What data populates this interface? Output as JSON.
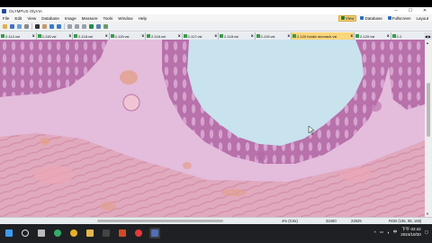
{
  "window": {
    "title": "OLYMPUS OlyVIA",
    "controls": {
      "minimize": "─",
      "maximize": "☐",
      "close": "✕"
    }
  },
  "menu": [
    "File",
    "Edit",
    "View",
    "Database",
    "Image",
    "Measure",
    "Tools",
    "Window",
    "Help"
  ],
  "right_tools": [
    {
      "label": "View",
      "active": true,
      "icon_color": "#2b7a2b"
    },
    {
      "label": "Database",
      "active": false,
      "icon_color": "#2a6fbf"
    },
    {
      "label": "Fullscreen",
      "active": false,
      "icon_color": "#2a6fbf"
    },
    {
      "label": "Layout",
      "active": false,
      "icon_color": "#555555"
    }
  ],
  "tabs": [
    {
      "label": "2-112.vsi",
      "active": false
    },
    {
      "label": "2-115.vsi",
      "active": false
    },
    {
      "label": "2-118.vsi",
      "active": false
    },
    {
      "label": "2-119.vsi",
      "active": false
    },
    {
      "label": "2-116.vsi",
      "active": false
    },
    {
      "label": "2-117.vsi",
      "active": false
    },
    {
      "label": "2-118.vsi",
      "active": false
    },
    {
      "label": "2-119.vsi",
      "active": false
    },
    {
      "label": "2-120 fundic stomach.vsi",
      "active": true
    },
    {
      "label": "2-120.vsi",
      "active": false
    },
    {
      "label": "2-1",
      "active": false
    }
  ],
  "tab_close": "x",
  "status": {
    "zoom": "4% (0.8x)",
    "width": "32450",
    "height": "22525",
    "rgb": "RGB (155, 88, 166)"
  },
  "taskbar": {
    "apps": [
      {
        "name": "windows-start",
        "color": "#3c9cf0"
      },
      {
        "name": "search",
        "color": "#dddddd"
      },
      {
        "name": "task-view",
        "color": "#bbbbbb"
      },
      {
        "name": "edge",
        "color": "#2fae6b"
      },
      {
        "name": "chrome",
        "color": "#e6b026"
      },
      {
        "name": "explorer",
        "color": "#e8b64a"
      },
      {
        "name": "store",
        "color": "#444444"
      },
      {
        "name": "powerpoint",
        "color": "#d04a25"
      },
      {
        "name": "recorder",
        "color": "#e23b3b"
      },
      {
        "name": "olyvia",
        "color": "#4f6fb8"
      }
    ],
    "tray_label": "中",
    "time_ampm": "下午",
    "time": "02:42",
    "date": "2024/10/20"
  },
  "colors": {
    "tissue_base": "#dba8d0",
    "mucosa": "#b56aa8",
    "muscle": "#e7a4b4",
    "lumen": "#c9e3ee",
    "active_tab": "#fbd67c"
  }
}
